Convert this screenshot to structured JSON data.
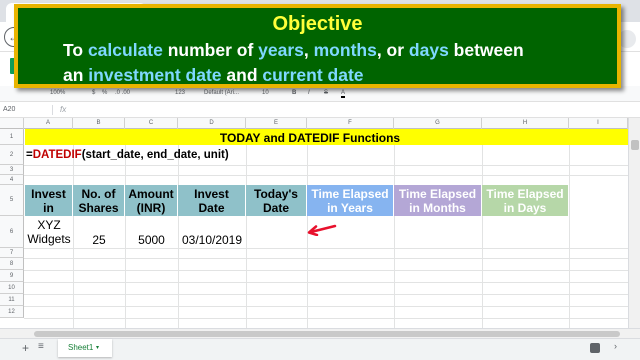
{
  "objective": {
    "title": "Objective",
    "line1": [
      {
        "t": "To ",
        "kw": false
      },
      {
        "t": "calculate",
        "kw": true
      },
      {
        "t": " number of ",
        "kw": false
      },
      {
        "t": "years",
        "kw": true
      },
      {
        "t": ", ",
        "kw": false
      },
      {
        "t": "months",
        "kw": true
      },
      {
        "t": ", or ",
        "kw": false
      },
      {
        "t": "days",
        "kw": true
      },
      {
        "t": " between",
        "kw": false
      }
    ],
    "line2": [
      {
        "t": "an ",
        "kw": false
      },
      {
        "t": "investment date",
        "kw": true
      },
      {
        "t": " and ",
        "kw": false
      },
      {
        "t": "current date",
        "kw": true
      }
    ]
  },
  "chrome": {
    "back_icon": "arrow-left",
    "back_glyph": "←"
  },
  "format_bar": {
    "zoom": "100%",
    "currency": "$",
    "percent": "%",
    "decimals": ".0  .00",
    "number_format": "123",
    "font": "Default (Ari...",
    "font_size": "10",
    "bold": "B",
    "italic": "I",
    "strike": "S",
    "text_color": "A"
  },
  "formula_bar": {
    "name_box": "A20",
    "fx": "fx",
    "content": ""
  },
  "columns": [
    "A",
    "B",
    "C",
    "D",
    "E",
    "F",
    "G",
    "H",
    "I"
  ],
  "rows": [
    "1",
    "2",
    "3",
    "4",
    "5",
    "6",
    "7",
    "8",
    "9",
    "10",
    "11",
    "12"
  ],
  "sheet": {
    "title": "TODAY and DATEDIF Functions",
    "formula": {
      "prefix": "=",
      "name": "DATEDIF",
      "args": "(start_date, end_date, unit)"
    },
    "headers": [
      {
        "line1": "Invest",
        "line2": "in"
      },
      {
        "line1": "No. of",
        "line2": "Shares"
      },
      {
        "line1": "Amount",
        "line2": "(INR)"
      },
      {
        "line1": "Invest",
        "line2": "Date"
      },
      {
        "line1": "Today's",
        "line2": "Date"
      },
      {
        "line1": "Time Elapsed",
        "line2": "in Years"
      },
      {
        "line1": "Time Elapsed",
        "line2": "in Months"
      },
      {
        "line1": "Time Elapsed",
        "line2": "in Days"
      }
    ],
    "row": {
      "invest_in_line1": "XYZ",
      "invest_in_line2": "Widgets",
      "shares": "25",
      "amount": "5000",
      "invest_date": "03/10/2019",
      "today": "",
      "years": "",
      "months": "",
      "days": ""
    },
    "colors": {
      "title_band": "#ffff00",
      "header_teal": "#8fc1c9",
      "header_blue": "#86b4f0",
      "header_purple": "#b4a7d6",
      "header_green": "#b6d7a8",
      "arrow": "#e8112d"
    }
  },
  "sheet_tabs": {
    "add": "+",
    "all": "≡",
    "active": "Sheet1",
    "caret": "▾"
  }
}
